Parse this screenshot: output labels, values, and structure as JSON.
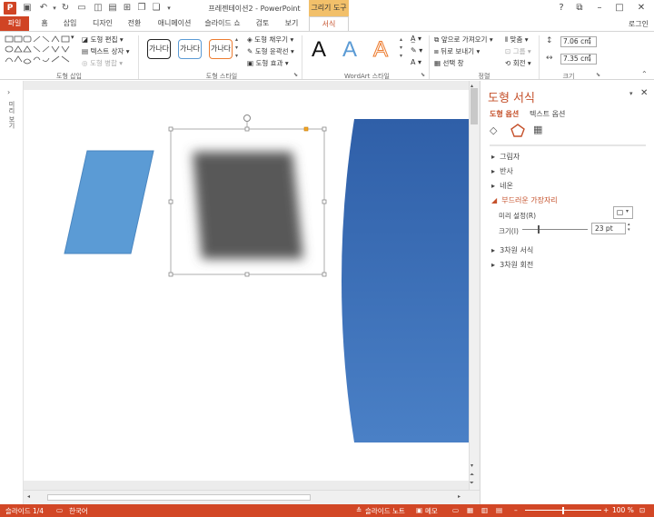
{
  "titlebar": {
    "title": "프레젠테이션2 - PowerPoint",
    "context_tab": "그리기 도구",
    "app_icon": "P"
  },
  "tabs": {
    "file": "파일",
    "items": [
      "홈",
      "삽입",
      "디자인",
      "전환",
      "애니메이션",
      "슬라이드 쇼",
      "검토",
      "보기",
      "서식"
    ],
    "login": "로그인"
  },
  "ribbon": {
    "insert_shapes": {
      "edit_shape": "도형 편집",
      "text_box": "텍스트 상자",
      "merge_shapes": "도형 병합",
      "label": "도형 삽입"
    },
    "shape_styles": {
      "preset_text": "가나다",
      "fill": "도형 채우기",
      "outline": "도형 윤곽선",
      "effects": "도형 효과",
      "label": "도형 스타일"
    },
    "wordart": {
      "letter": "A",
      "label": "WordArt 스타일"
    },
    "arrange": {
      "bring_forward": "앞으로 가져오기",
      "send_backward": "뒤로 보내기",
      "selection_pane": "선택 창",
      "align": "맞춤",
      "group": "그룹",
      "rotate": "회전",
      "label": "정렬"
    },
    "size": {
      "height": "7.06 cm",
      "width": "7.35 cm",
      "label": "크기"
    }
  },
  "left_strip": {
    "label": "미리 보기"
  },
  "format_pane": {
    "title": "도형 서식",
    "tab_shape_options": "도형 옵션",
    "tab_text_options": "텍스트 옵션",
    "sections": [
      "그림자",
      "반사",
      "네온",
      "부드러운 가장자리",
      "3차원 서식",
      "3차원 회전"
    ],
    "expanded": "부드러운 가장자리",
    "preset_label": "미리 설정(R)",
    "size_label": "크기(I)",
    "size_value": "23 pt",
    "soft_edge_fraction": 0.23
  },
  "statusbar": {
    "slide": "슬라이드 1/4",
    "language": "한국어",
    "notes": "슬라이드 노트",
    "comments": "메모",
    "zoom": "100 %"
  },
  "colors": {
    "accent": "#d24726",
    "shape_blue": "#5b9bd5",
    "blurred_shape": "#595959",
    "gradient_top": "#2f5fa8",
    "gradient_bottom": "#4a80c6"
  }
}
